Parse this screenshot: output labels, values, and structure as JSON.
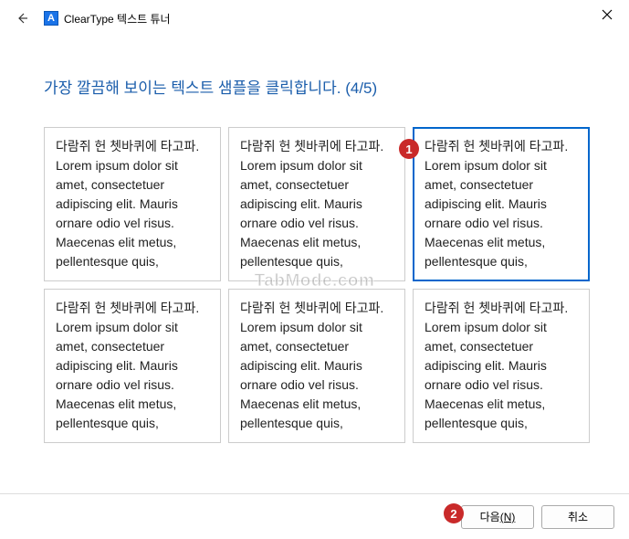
{
  "titlebar": {
    "app_icon_letter": "A",
    "title": "ClearType 텍스트 튜너"
  },
  "heading": "가장 깔끔해 보이는 텍스트 샘플을 클릭합니다. (4/5)",
  "sample_text": "다람쥐 헌 쳇바퀴에 타고파. Lorem ipsum dolor sit amet, consectetuer adipiscing elit. Mauris ornare odio vel risus. Maecenas elit metus, pellentesque quis,",
  "samples": [
    {
      "selected": false
    },
    {
      "selected": false
    },
    {
      "selected": true
    },
    {
      "selected": false
    },
    {
      "selected": false
    },
    {
      "selected": false
    }
  ],
  "watermark": "TabMode.com",
  "markers": {
    "m1": "1",
    "m2": "2"
  },
  "footer": {
    "next_label": "다음",
    "next_key": "(N)",
    "cancel_label": "취소"
  }
}
